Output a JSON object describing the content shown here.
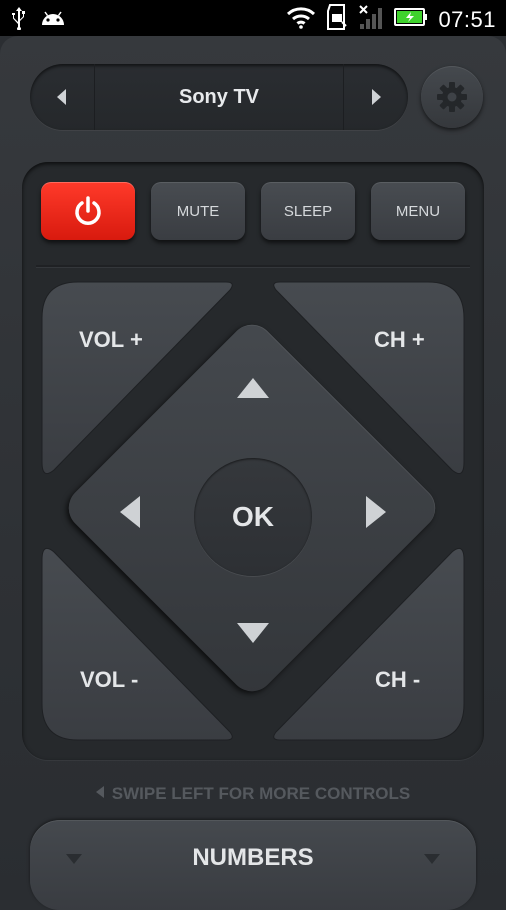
{
  "status_bar": {
    "time": "07:51",
    "icons": [
      "usb-icon",
      "android-icon",
      "wifi-icon",
      "sd-card-icon",
      "no-signal-icon",
      "battery-charging-icon"
    ],
    "colors": {
      "battery": "#3fd22d"
    }
  },
  "device_selector": {
    "title": "Sony TV",
    "prev_icon": "triangle-left-icon",
    "next_icon": "triangle-right-icon"
  },
  "settings": {
    "icon": "gear-icon"
  },
  "top_buttons": {
    "power_icon": "power-icon",
    "mute": "MUTE",
    "sleep": "SLEEP",
    "menu": "MENU",
    "colors": {
      "power": "#e8200f"
    }
  },
  "controls": {
    "vol_up": "VOL +",
    "ch_up": "CH +",
    "vol_down": "VOL -",
    "ch_down": "CH -",
    "ok": "OK"
  },
  "hint": "SWIPE LEFT FOR MORE CONTROLS",
  "numbers": {
    "label": "NUMBERS"
  }
}
